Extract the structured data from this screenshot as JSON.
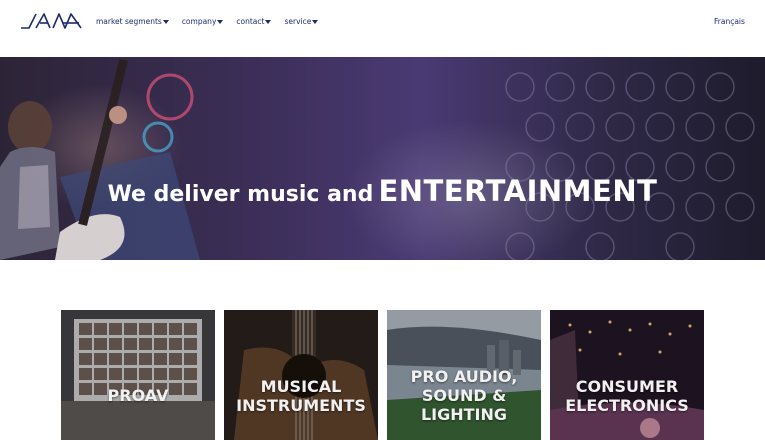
{
  "header": {
    "nav": [
      {
        "label": "market segments"
      },
      {
        "label": "company"
      },
      {
        "label": "contact"
      },
      {
        "label": "service"
      }
    ],
    "language": "Français"
  },
  "hero": {
    "title_part1": "We deliver music and",
    "title_part2": "ENTERTAINMENT"
  },
  "cards": [
    {
      "label": "PROAV"
    },
    {
      "label": "MUSICAL\nINSTRUMENTS"
    },
    {
      "label": "PRO AUDIO,\nSOUND &\nLIGHTING"
    },
    {
      "label": "CONSUMER\nELECTRONICS"
    }
  ],
  "colors": {
    "nav_text": "#1f2a6e",
    "hero_overlay": "#3d2f5a"
  }
}
